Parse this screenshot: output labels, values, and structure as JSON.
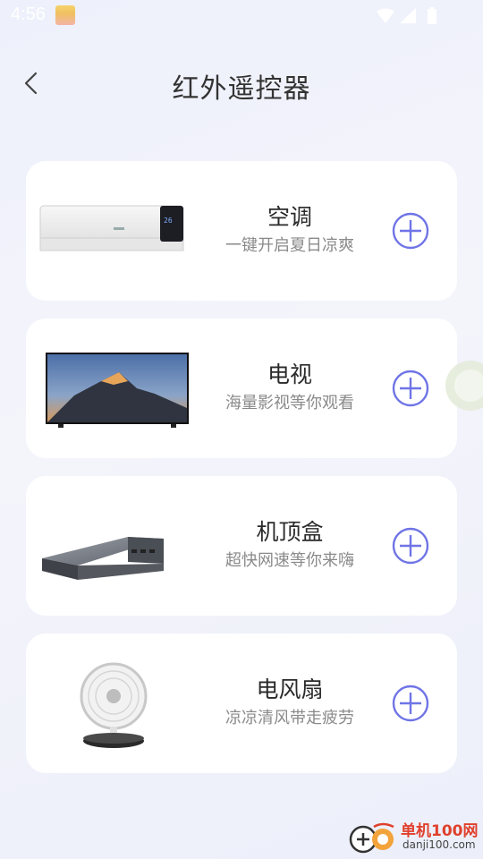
{
  "status_bar": {
    "time": "4:56"
  },
  "header": {
    "title": "红外遥控器"
  },
  "devices": [
    {
      "name": "空调",
      "desc": "一键开启夏日凉爽"
    },
    {
      "name": "电视",
      "desc": "海量影视等你观看"
    },
    {
      "name": "机顶盒",
      "desc": "超快网速等你来嗨"
    },
    {
      "name": "电风扇",
      "desc": "凉凉清风带走疲劳"
    }
  ],
  "watermark": {
    "name": "单机100网",
    "url": "danji100.com"
  },
  "colors": {
    "accent": "#6f74e6",
    "card_bg": "#ffffff",
    "background": "#eef1fb"
  }
}
